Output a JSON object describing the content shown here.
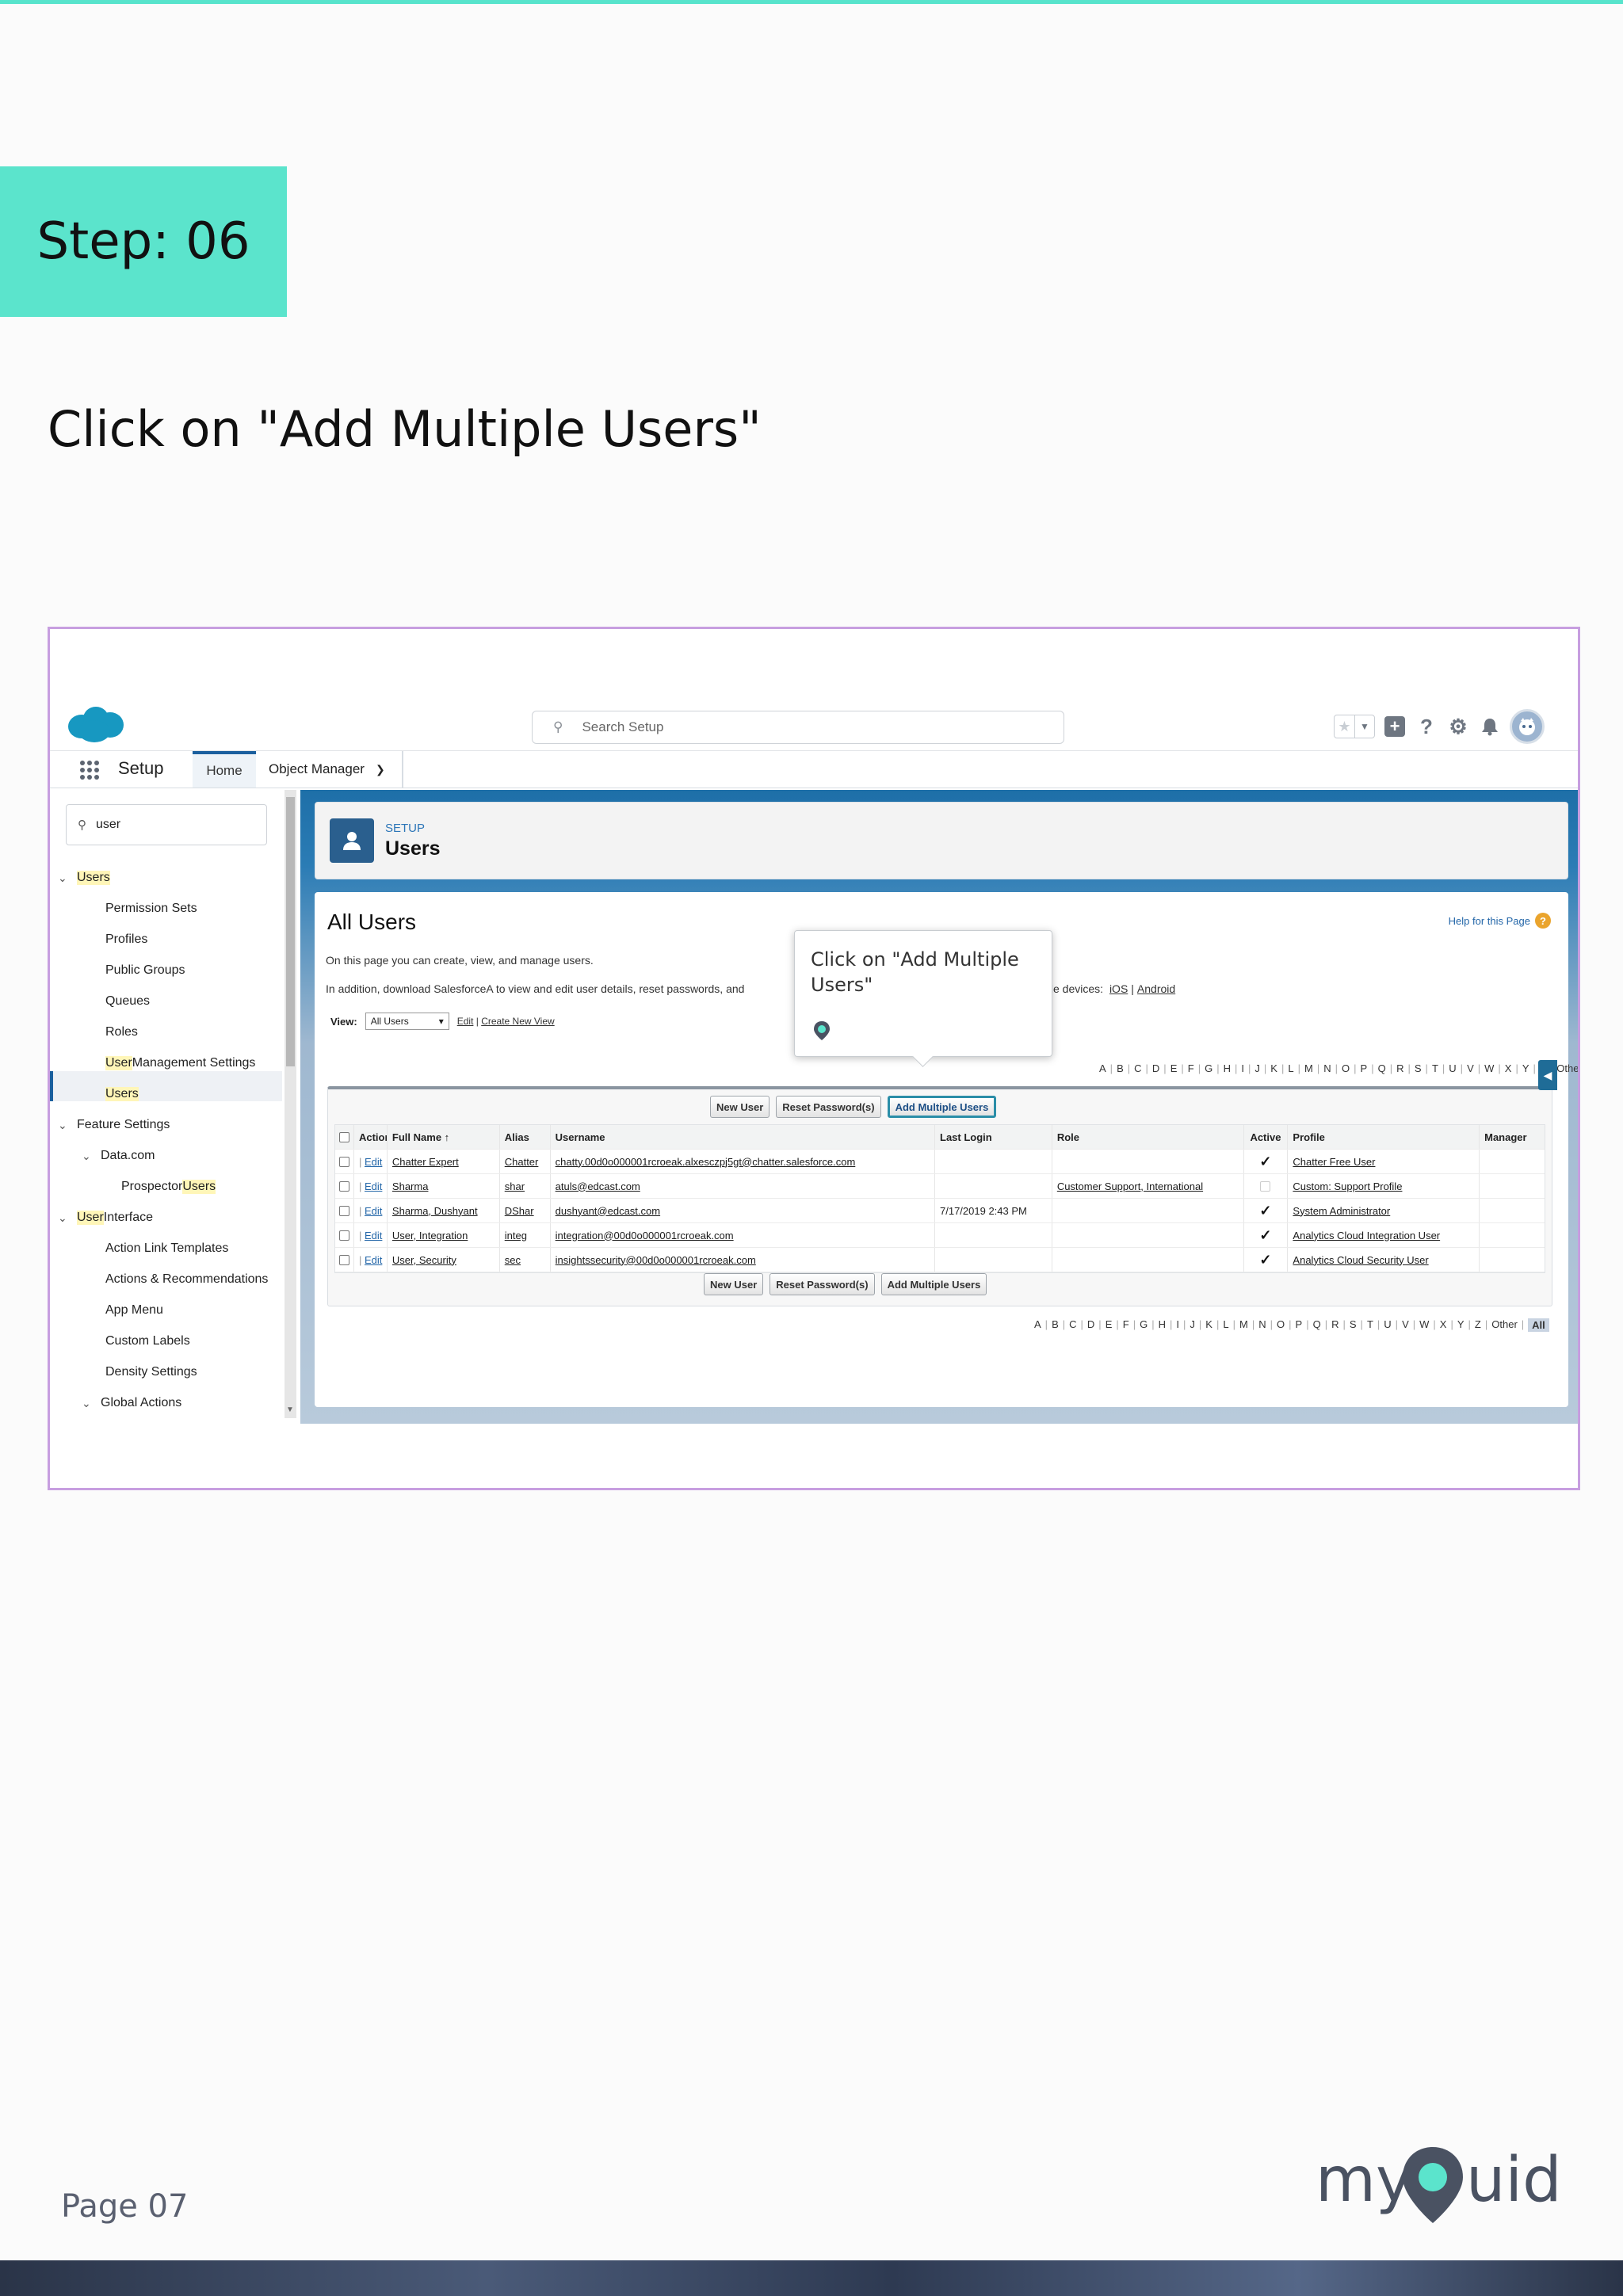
{
  "step": {
    "label": "Step: 06"
  },
  "instruction": "Click on \"Add Multiple Users\"",
  "page_number": "Page 07",
  "brand": {
    "text_left": "my",
    "text_right": "uide",
    "accent": "#5be4cc",
    "dark": "#4a5262"
  },
  "salesforce": {
    "search_placeholder": "Search Setup",
    "app_name": "Setup",
    "tabs": [
      {
        "label": "Home",
        "active": true
      },
      {
        "label": "Object Manager"
      }
    ],
    "sidebar": {
      "search_value": "user",
      "items": [
        {
          "label": "Users",
          "level": 0,
          "expanded": true
        },
        {
          "label": "Permission Sets",
          "level": 1
        },
        {
          "label": "Profiles",
          "level": 1
        },
        {
          "label": "Public Groups",
          "level": 1
        },
        {
          "label": "Queues",
          "level": 1
        },
        {
          "label": "Roles",
          "level": 1
        },
        {
          "label_pre": "User",
          "label_post": " Management Settings",
          "level": 1
        },
        {
          "label": "Users",
          "level": 1,
          "active": true
        },
        {
          "label": "Feature Settings",
          "level": 0,
          "expanded": true
        },
        {
          "label": "Data.com",
          "level": 1,
          "expanded": true
        },
        {
          "label_pre": "Prospector ",
          "label_post": "Users",
          "level": 2
        },
        {
          "label_pre": "User",
          "label_post": " Interface",
          "level": 0,
          "expanded": true
        },
        {
          "label": "Action Link Templates",
          "level": 1
        },
        {
          "label": "Actions & Recommendations",
          "level": 1
        },
        {
          "label": "App Menu",
          "level": 1
        },
        {
          "label": "Custom Labels",
          "level": 1
        },
        {
          "label": "Density Settings",
          "level": 1
        },
        {
          "label": "Global Actions",
          "level": 1,
          "expanded": true
        }
      ]
    },
    "page_header": {
      "eyebrow": "SETUP",
      "title": "Users"
    },
    "content": {
      "title": "All Users",
      "help_link": "Help for this Page",
      "intro_line": "On this page you can create, view, and manage users.",
      "download_line_a": "In addition, download SalesforceA to view and edit user details, reset passwords, and",
      "download_line_b": "bile devices:",
      "ios": "iOS",
      "android": "Android",
      "view_label": "View:",
      "view_value": "All Users",
      "edit_link": "Edit",
      "create_view_link": "Create New View",
      "alphabet": [
        "A",
        "B",
        "C",
        "D",
        "E",
        "F",
        "G",
        "H",
        "I",
        "J",
        "K",
        "L",
        "M",
        "N",
        "O",
        "P",
        "Q",
        "R",
        "S",
        "T",
        "U",
        "V",
        "W",
        "X",
        "Y",
        "Z",
        "Other",
        "All"
      ],
      "buttons": {
        "new_user": "New User",
        "reset_password": "Reset Password(s)",
        "add_multiple": "Add Multiple Users"
      },
      "columns": {
        "action": "Action",
        "full_name": "Full Name",
        "sort_icon": "↑",
        "alias": "Alias",
        "username": "Username",
        "last_login": "Last Login",
        "role": "Role",
        "active": "Active",
        "profile": "Profile",
        "manager": "Manager"
      },
      "rows": [
        {
          "edit": "Edit",
          "name": "Chatter Expert",
          "alias": "Chatter",
          "username": "chatty.00d0o000001rcroeak.alxesczpj5gt@chatter.salesforce.com",
          "last_login": "",
          "role": "",
          "active": true,
          "profile": "Chatter Free User"
        },
        {
          "edit": "Edit",
          "name": "Sharma",
          "alias": "shar",
          "username": "atuls@edcast.com",
          "last_login": "",
          "role": "Customer Support, International",
          "active": false,
          "profile": "Custom: Support Profile"
        },
        {
          "edit": "Edit",
          "name": "Sharma, Dushyant",
          "alias": "DShar",
          "username": "dushyant@edcast.com",
          "last_login": "7/17/2019 2:43 PM",
          "role": "",
          "active": true,
          "profile": "System Administrator"
        },
        {
          "edit": "Edit",
          "name": "User, Integration",
          "alias": "integ",
          "username": "integration@00d0o000001rcroeak.com",
          "last_login": "",
          "role": "",
          "active": true,
          "profile": "Analytics Cloud Integration User"
        },
        {
          "edit": "Edit",
          "name": "User, Security",
          "alias": "sec",
          "username": "insightssecurity@00d0o000001rcroeak.com",
          "last_login": "",
          "role": "",
          "active": true,
          "profile": "Analytics Cloud Security User"
        }
      ]
    },
    "tooltip": {
      "text": "Click on \"Add Multiple Users\""
    }
  }
}
